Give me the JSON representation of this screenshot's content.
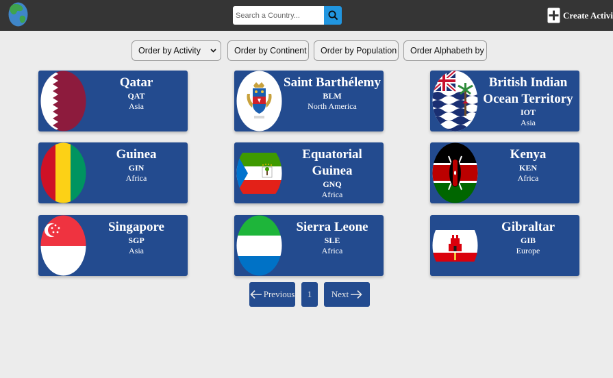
{
  "header": {
    "search": {
      "placeholder": "Search a Country...",
      "value": ""
    },
    "create_activity_label": "Create Activity"
  },
  "filters": [
    {
      "label": "Order by Activity"
    },
    {
      "label": "Order by Continent"
    },
    {
      "label": "Order by Population"
    },
    {
      "label": "Order Alphabeth by"
    }
  ],
  "countries": [
    {
      "name": "Qatar",
      "code": "QAT",
      "continent": "Asia",
      "flag": "qatar-flag"
    },
    {
      "name": "Saint Barthélemy",
      "code": "BLM",
      "continent": "North America",
      "flag": "saint-barthelemy-flag"
    },
    {
      "name": "British Indian Ocean Territory",
      "code": "IOT",
      "continent": "Asia",
      "flag": "british-indian-ocean-territory-flag"
    },
    {
      "name": "Guinea",
      "code": "GIN",
      "continent": "Africa",
      "flag": "guinea-flag"
    },
    {
      "name": "Equatorial Guinea",
      "code": "GNQ",
      "continent": "Africa",
      "flag": "equatorial-guinea-flag"
    },
    {
      "name": "Kenya",
      "code": "KEN",
      "continent": "Africa",
      "flag": "kenya-flag"
    },
    {
      "name": "Singapore",
      "code": "SGP",
      "continent": "Asia",
      "flag": "singapore-flag"
    },
    {
      "name": "Sierra Leone",
      "code": "SLE",
      "continent": "Africa",
      "flag": "sierra-leone-flag"
    },
    {
      "name": "Gibraltar",
      "code": "GIB",
      "continent": "Europe",
      "flag": "gibraltar-flag"
    }
  ],
  "pagination": {
    "previous_label": "Previous",
    "current_page": "1",
    "next_label": "Next"
  },
  "colors": {
    "topbar": "#353535",
    "card": "#234b8f",
    "search_button": "#2196e0",
    "background": "#ececec"
  }
}
